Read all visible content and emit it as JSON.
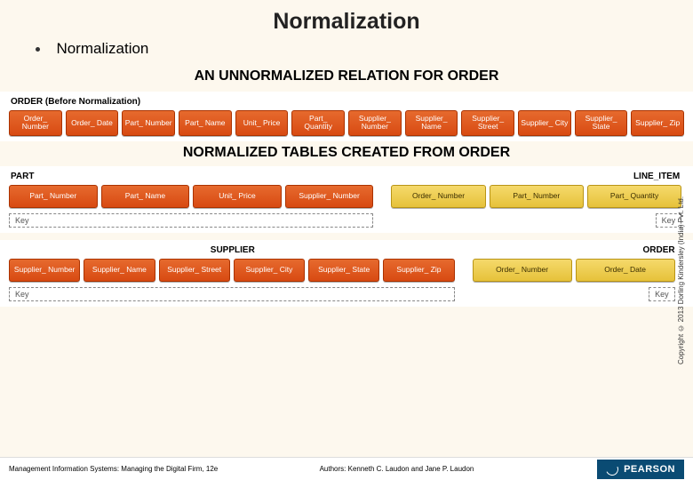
{
  "title": "Normalization",
  "bullet": "Normalization",
  "sub1": "AN UNNORMALIZED RELATION FOR ORDER",
  "sub2": "NORMALIZED TABLES CREATED FROM ORDER",
  "order_before": {
    "caption": "ORDER (Before Normalization)",
    "cols": [
      "Order_ Number",
      "Order_ Date",
      "Part_ Number",
      "Part_ Name",
      "Unit_ Price",
      "Part_ Quantity",
      "Supplier_ Number",
      "Supplier_ Name",
      "Supplier_ Street",
      "Supplier_ City",
      "Supplier_ State",
      "Supplier_ Zip"
    ]
  },
  "part": {
    "caption": "PART",
    "cols": [
      "Part_ Number",
      "Part_ Name",
      "Unit_ Price",
      "Supplier_ Number"
    ],
    "key": "Key"
  },
  "line_item": {
    "caption": "LINE_ITEM",
    "cols": [
      "Order_ Number",
      "Part_ Number",
      "Part_ Quantity"
    ],
    "key": "Key"
  },
  "supplier": {
    "caption": "SUPPLIER",
    "cols": [
      "Supplier_ Number",
      "Supplier_ Name",
      "Supplier_ Street",
      "Supplier_ City",
      "Supplier_ State",
      "Supplier_ Zip"
    ],
    "key": "Key"
  },
  "order": {
    "caption": "ORDER",
    "cols": [
      "Order_ Number",
      "Order_ Date"
    ],
    "key": "Key"
  },
  "copyright": "Copyright © 2013 Dorling Kindersley (India) Pvt. Ltd.",
  "footer_left": "Management Information Systems: Managing the Digital Firm, 12e",
  "footer_mid": "Authors: Kenneth C. Laudon and Jane P. Laudon",
  "logo": "PEARSON"
}
